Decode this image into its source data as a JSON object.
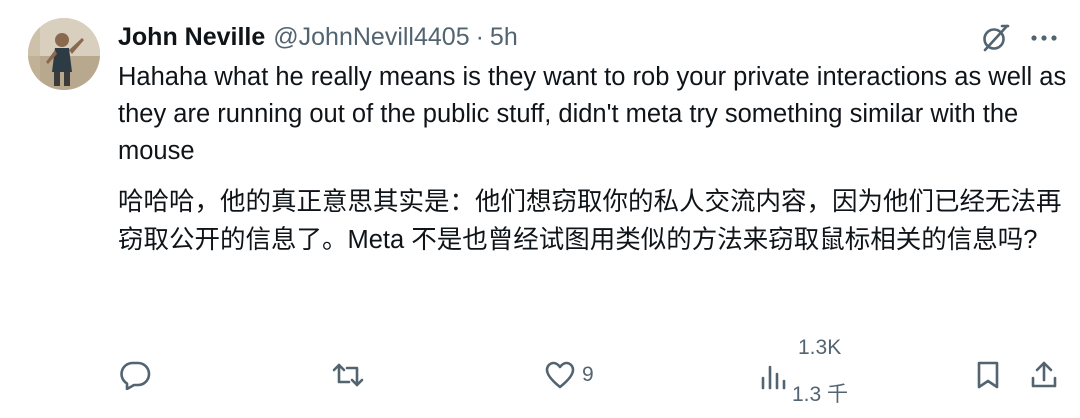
{
  "author": {
    "display_name": "John Neville",
    "handle": "@JohnNevill4405",
    "separator": "·",
    "time": "5h"
  },
  "content": {
    "english": "Hahaha what he really means is they want to rob your private interactions as well as they are running out of the public stuff, didn't meta try something similar with the mouse",
    "chinese": "哈哈哈，他的真正意思其实是：他们想窃取你的私人交流内容，因为他们已经无法再窃取公开的信息了。Meta 不是也曾经试图用类似的方法来窃取鼠标相关的信息吗?"
  },
  "actions": {
    "reply_icon": "reply-icon",
    "retweet_icon": "retweet-icon",
    "like_icon": "heart-icon",
    "like_count": "9",
    "views_icon": "analytics-icon",
    "views_count": "1.3K",
    "views_count_translated": "1.3 千",
    "bookmark_icon": "bookmark-icon",
    "share_icon": "share-icon"
  },
  "header_icons": [
    "grok-icon",
    "more-options-icon"
  ],
  "colors": {
    "text_primary": "#0f1419",
    "text_secondary": "#536471"
  }
}
